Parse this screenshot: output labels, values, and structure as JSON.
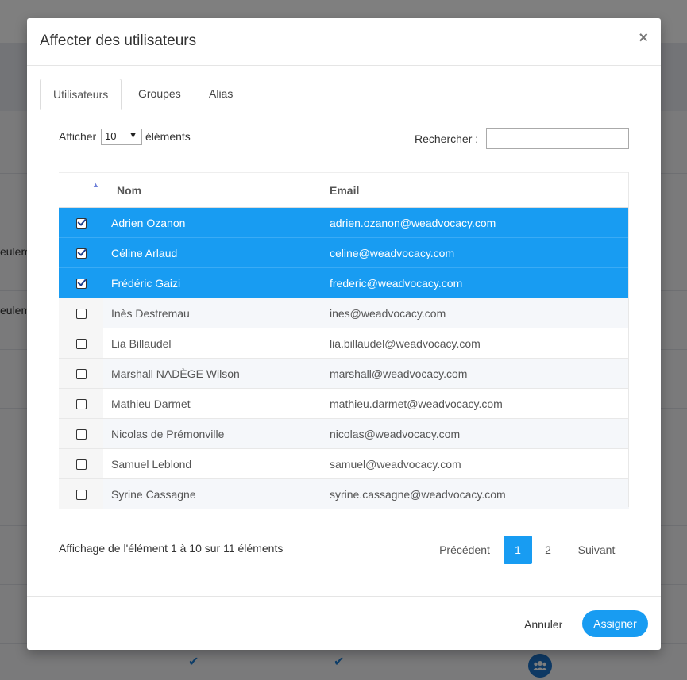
{
  "background": {
    "side_texts": [
      "eulem",
      "eulem"
    ]
  },
  "modal": {
    "title": "Affecter des utilisateurs",
    "close_label": "×",
    "tabs": [
      {
        "label": "Utilisateurs",
        "active": true
      },
      {
        "label": "Groupes",
        "active": false
      },
      {
        "label": "Alias",
        "active": false
      }
    ],
    "length": {
      "prefix": "Afficher",
      "value": "10",
      "suffix": "éléments"
    },
    "search": {
      "label": "Rechercher :",
      "value": ""
    },
    "table": {
      "columns": [
        "",
        "Nom",
        "Email"
      ],
      "sort_indicator": "▲",
      "rows": [
        {
          "checked": true,
          "name": "Adrien Ozanon",
          "email": "adrien.ozanon@weadvocacy.com"
        },
        {
          "checked": true,
          "name": "Céline Arlaud",
          "email": "celine@weadvocacy.com"
        },
        {
          "checked": true,
          "name": "Frédéric Gaizi",
          "email": "frederic@weadvocacy.com"
        },
        {
          "checked": false,
          "name": "Inès Destremau",
          "email": "ines@weadvocacy.com"
        },
        {
          "checked": false,
          "name": "Lia Billaudel",
          "email": "lia.billaudel@weadvocacy.com"
        },
        {
          "checked": false,
          "name": "Marshall NADÈGE Wilson",
          "email": "marshall@weadvocacy.com"
        },
        {
          "checked": false,
          "name": "Mathieu Darmet",
          "email": "mathieu.darmet@weadvocacy.com"
        },
        {
          "checked": false,
          "name": "Nicolas de Prémonville",
          "email": "nicolas@weadvocacy.com"
        },
        {
          "checked": false,
          "name": "Samuel Leblond",
          "email": "samuel@weadvocacy.com"
        },
        {
          "checked": false,
          "name": "Syrine Cassagne",
          "email": "syrine.cassagne@weadvocacy.com"
        }
      ]
    },
    "info": "Affichage de l'élément 1 à 10 sur 11 éléments",
    "pagination": {
      "previous": "Précédent",
      "pages": [
        "1",
        "2"
      ],
      "current": "1",
      "next": "Suivant"
    },
    "footer": {
      "cancel_label": "Annuler",
      "assign_label": "Assigner"
    }
  },
  "colors": {
    "accent": "#189cf2",
    "overlay": "rgba(0,0,0,0.5)"
  }
}
